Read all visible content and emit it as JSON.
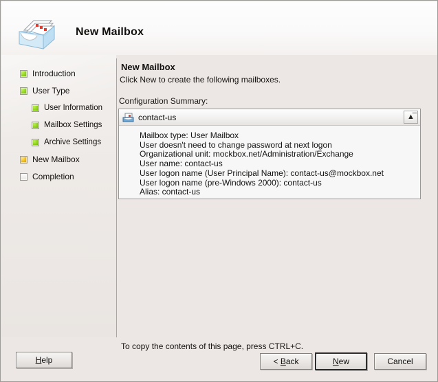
{
  "window": {
    "title": "New Mailbox",
    "banner_icon": "mailbox-tray-icon"
  },
  "sidebar": {
    "items": [
      {
        "label": "Introduction",
        "state": "green",
        "level": 0,
        "icon": "status-square-icon"
      },
      {
        "label": "User Type",
        "state": "green",
        "level": 0,
        "icon": "status-square-icon"
      },
      {
        "label": "User Information",
        "state": "green",
        "level": 1,
        "icon": "status-square-icon"
      },
      {
        "label": "Mailbox Settings",
        "state": "green",
        "level": 1,
        "icon": "status-square-icon"
      },
      {
        "label": "Archive Settings",
        "state": "green",
        "level": 1,
        "icon": "status-square-icon"
      },
      {
        "label": "New Mailbox",
        "state": "amber",
        "level": 0,
        "icon": "status-square-icon"
      },
      {
        "label": "Completion",
        "state": "empty",
        "level": 0,
        "icon": "status-square-icon"
      }
    ]
  },
  "content": {
    "heading": "New Mailbox",
    "subtext": "Click New to create the following mailboxes.",
    "summary_caption": "Configuration Summary:",
    "summary": {
      "header_title": "contact-us",
      "header_icon": "mailbox-icon",
      "collapse_icon": "chevron-double-up-icon",
      "details": [
        "Mailbox type: User Mailbox",
        "User doesn't need to change password at next logon",
        "Organizational unit: mockbox.net/Administration/Exchange",
        "User name: contact-us",
        "User logon name (User Principal Name): contact-us@mockbox.net",
        "User logon name (pre-Windows 2000): contact-us",
        "Alias: contact-us"
      ]
    }
  },
  "footer": {
    "hint": "To copy the contents of this page, press CTRL+C.",
    "buttons": {
      "help": {
        "prefix": "",
        "accel": "H",
        "suffix": "elp"
      },
      "back": {
        "prefix": "< ",
        "accel": "B",
        "suffix": "ack"
      },
      "new": {
        "prefix": "",
        "accel": "N",
        "suffix": "ew"
      },
      "cancel": {
        "prefix": "Cancel",
        "accel": "",
        "suffix": ""
      }
    }
  },
  "colors": {
    "window_background": "#ece7e4",
    "banner_background": "#fdfdfe",
    "sidebar_background": "#eeeae7",
    "listbox_background": "#f7f7f7",
    "status_green": "#92d41d",
    "status_amber": "#f3bc12",
    "text": "#141312"
  }
}
